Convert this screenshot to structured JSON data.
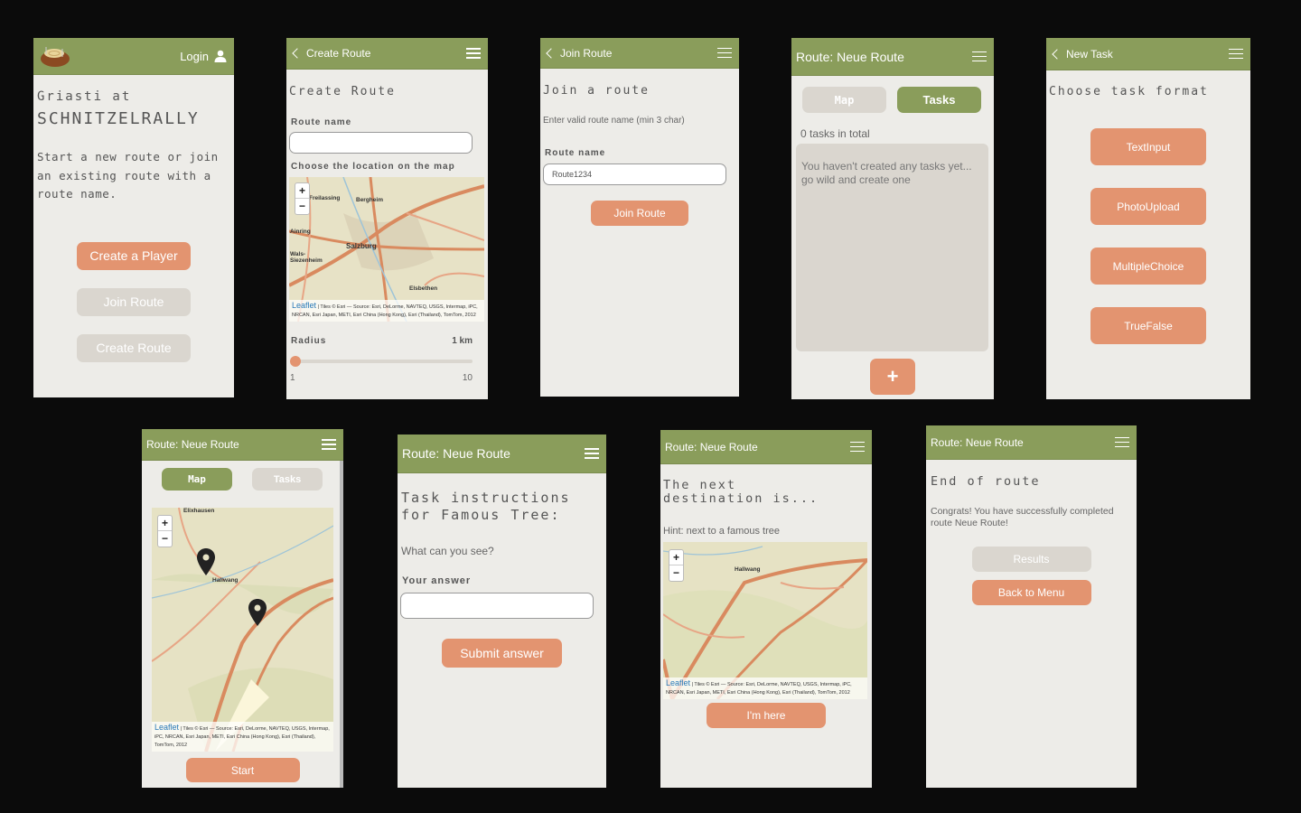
{
  "colors": {
    "header": "#8a9d5b",
    "accent": "#e39470",
    "disabled": "#dad6cf",
    "background": "#edece8"
  },
  "screens": {
    "home": {
      "logo": "tree-stump-logo",
      "login_label": "Login",
      "title_line1": "Griasti at",
      "title_line2": "SCHNITZELRALLY",
      "description": "Start a new route or join an existing route with a route name.",
      "buttons": [
        "Create a Player",
        "Join Route",
        "Create Route"
      ]
    },
    "create_route": {
      "header": "Create Route",
      "heading": "Create Route",
      "route_name_label": "Route name",
      "route_name_value": "",
      "map_label": "Choose the location on the map",
      "map_places": [
        "Freilassing",
        "Bergheim",
        "Ainring",
        "Salzburg",
        "Wals-Siezenheim",
        "Elsbethen"
      ],
      "attribution_link": "Leaflet",
      "attribution": "| Tiles © Esri — Source: Esri, DeLorme, NAVTEQ, USGS, Intermap, iPC, NRCAN, Esri Japan, METI, Esri China (Hong Kong), Esri (Thailand), TomTom, 2012",
      "radius_label": "Radius",
      "radius_value": "1 km",
      "radius_min": "1",
      "radius_max": "10",
      "radius_fraction": 0.0
    },
    "join_route": {
      "header": "Join Route",
      "heading": "Join a route",
      "hint": "Enter valid route name (min 3 char)",
      "route_name_label": "Route name",
      "route_name_value": "Route1234",
      "button": "Join Route"
    },
    "route_tasks": {
      "header": "Route: Neue Route",
      "tab_map": "Map",
      "tab_tasks": "Tasks",
      "count": "0 tasks in total",
      "empty": "You haven't created any tasks yet... go wild and create one",
      "add_label": "+"
    },
    "new_task": {
      "header": "New Task",
      "heading": "Choose task format",
      "formats": [
        "TextInput",
        "PhotoUpload",
        "MultipleChoice",
        "TrueFalse"
      ]
    },
    "route_map": {
      "header": "Route: Neue Route",
      "tab_map": "Map",
      "tab_tasks": "Tasks",
      "map_places": [
        "Elixhausen",
        "Hallwang"
      ],
      "attribution_link": "Leaflet",
      "attribution": "| Tiles © Esri — Source: Esri, DeLorme, NAVTEQ, USGS, Intermap, iPC, NRCAN, Esri Japan, METI, Esri China (Hong Kong), Esri (Thailand), TomTom, 2012",
      "button": "Start"
    },
    "task_instructions": {
      "header": "Route: Neue Route",
      "heading": "Task instructions for Famous Tree:",
      "question": "What can you see?",
      "answer_label": "Your answer",
      "answer_value": "",
      "button": "Submit answer"
    },
    "next_destination": {
      "header": "Route: Neue Route",
      "heading": "The next destination is...",
      "hint": "Hint: next to a famous tree",
      "map_places": [
        "Hallwang"
      ],
      "attribution_link": "Leaflet",
      "attribution": "| Tiles © Esri — Source: Esri, DeLorme, NAVTEQ, USGS, Intermap, iPC, NRCAN, Esri Japan, METI, Esri China (Hong Kong), Esri (Thailand), TomTom, 2012",
      "button": "I'm here"
    },
    "end_of_route": {
      "header": "Route: Neue Route",
      "heading": "End of route",
      "message": "Congrats! You have successfully completed route Neue Route!",
      "buttons": [
        "Results",
        "Back to Menu"
      ]
    }
  }
}
